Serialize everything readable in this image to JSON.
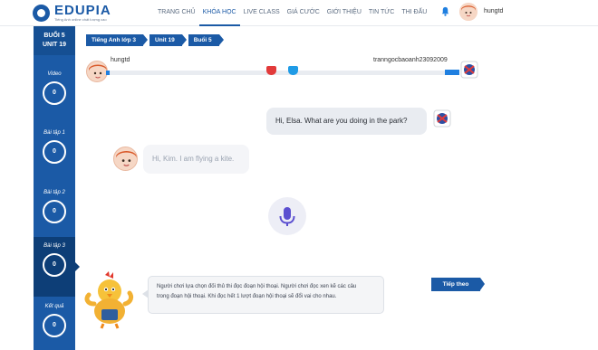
{
  "header": {
    "logo_name": "EDUPIA",
    "logo_tagline": "Tiếng Anh online chất lượng cao",
    "nav": [
      "TRANG CHỦ",
      "KHÓA HỌC",
      "LIVE CLASS",
      "GIÁ CƯỚC",
      "GIỚI THIỆU",
      "TIN TỨC",
      "THI ĐẤU"
    ],
    "active_nav": "KHÓA HỌC",
    "username": "hungtd"
  },
  "sidebar": {
    "session": "BUỔI 5",
    "unit": "UNIT 19",
    "items": [
      {
        "label": "Video",
        "score": "0"
      },
      {
        "label": "Bài tập 1",
        "score": "0"
      },
      {
        "label": "Bài tập 2",
        "score": "0"
      },
      {
        "label": "Bài tập 3",
        "score": "0",
        "active": true
      },
      {
        "label": "Kết quả",
        "score": "0"
      }
    ]
  },
  "breadcrumb": [
    "Tiếng Anh lớp 3",
    "Unit 19",
    "Buổi 5"
  ],
  "battle": {
    "player1": "hungtd",
    "player2": "tranngocbaoanh23092009"
  },
  "chat": {
    "elsa_line": "Hi, Elsa. What are you doing in the park?",
    "kim_line": "Hi, Kim. I am flying a kite."
  },
  "hint": {
    "line1": "Người chơi lựa chọn đối thủ thi đọc đoạn hội thoại. Người chơi đọc xen kẽ các câu",
    "line2": "trong đoạn hội thoại. Khi đọc hết 1 lượt đoạn hội thoại sẽ đổi vai cho nhau."
  },
  "next_label": "Tiếp theo",
  "colors": {
    "primary": "#1b5aa6",
    "sidebar_active": "#0d3e77",
    "track_fill": "#1f7fe0",
    "mic": "#5b4fd0"
  }
}
